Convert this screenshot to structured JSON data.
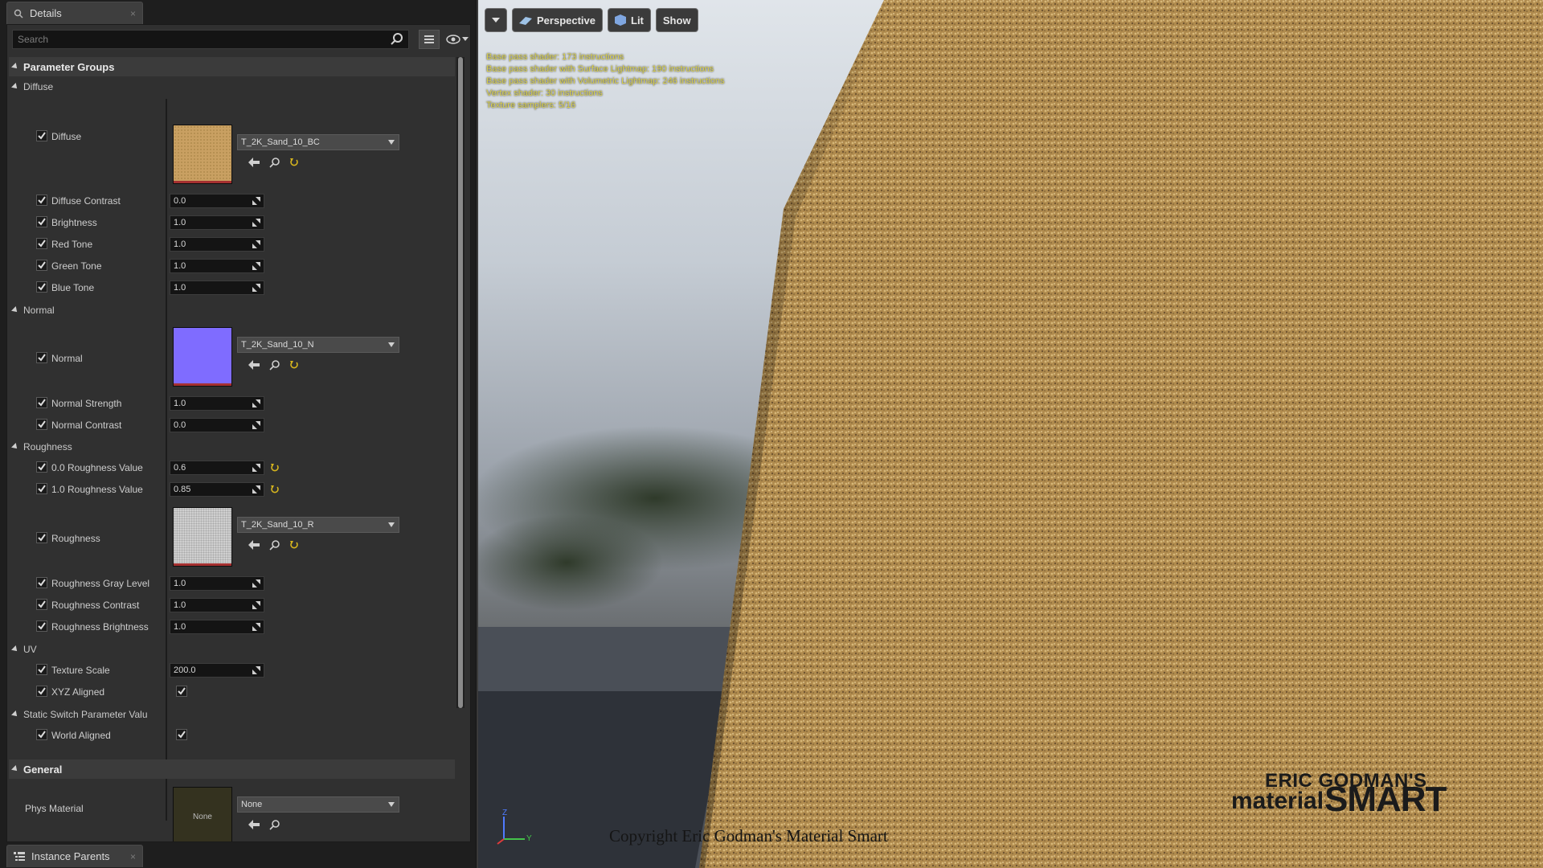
{
  "details_tab": {
    "title": "Details",
    "close": "×"
  },
  "search": {
    "placeholder": "Search"
  },
  "categories": {
    "parameter_groups": "Parameter Groups",
    "general": "General"
  },
  "groups": {
    "diffuse": "Diffuse",
    "normal": "Normal",
    "roughness": "Roughness",
    "uv": "UV",
    "static_switch": "Static Switch Parameter Valu"
  },
  "diffuse": {
    "texture_label": "Diffuse",
    "texture_name": "T_2K_Sand_10_BC",
    "params": [
      {
        "label": "Diffuse Contrast",
        "value": "0.0"
      },
      {
        "label": "Brightness",
        "value": "1.0"
      },
      {
        "label": "Red Tone",
        "value": "1.0"
      },
      {
        "label": "Green Tone",
        "value": "1.0"
      },
      {
        "label": "Blue Tone",
        "value": "1.0"
      }
    ]
  },
  "normal": {
    "texture_label": "Normal",
    "texture_name": "T_2K_Sand_10_N",
    "params": [
      {
        "label": "Normal Strength",
        "value": "1.0"
      },
      {
        "label": "Normal Contrast",
        "value": "0.0"
      }
    ]
  },
  "roughness": {
    "values": [
      {
        "label": "0.0 Roughness Value",
        "value": "0.6"
      },
      {
        "label": "1.0 Roughness Value",
        "value": "0.85"
      }
    ],
    "texture_label": "Roughness",
    "texture_name": "T_2K_Sand_10_R",
    "params": [
      {
        "label": "Roughness Gray Level",
        "value": "1.0"
      },
      {
        "label": "Roughness Contrast",
        "value": "1.0"
      },
      {
        "label": "Roughness Brightness",
        "value": "1.0"
      }
    ]
  },
  "uv": {
    "texture_scale_label": "Texture Scale",
    "texture_scale_value": "200.0",
    "xyz_aligned_label": "XYZ Aligned"
  },
  "static_switch": {
    "world_aligned_label": "World Aligned"
  },
  "general": {
    "phys_material_label": "Phys Material",
    "thumb_text": "None",
    "combo_value": "None"
  },
  "instance_parents_tab": {
    "title": "Instance Parents",
    "close": "×"
  },
  "viewport": {
    "perspective": "Perspective",
    "lit": "Lit",
    "show": "Show",
    "stats": [
      "Base pass shader: 173 instructions",
      "Base pass shader with Surface Lightmap: 190 instructions",
      "Base pass shader with Volumetric Lightmap: 246 instructions",
      "Vertex shader: 30 instructions",
      "Texture samplers: 5/16"
    ],
    "copyright": "Copyright Eric Godman's Material Smart",
    "logo_line1": "ERIC GODMAN'S",
    "logo_line2": "material",
    "logo_line3": "SMART",
    "gizmo_z": "Z",
    "gizmo_y": "Y"
  },
  "colors": {
    "panel_bg": "#303030",
    "diffuse_swatch": "#c9a062",
    "normal_swatch": "#7f6cff",
    "roughness_swatch": "#cfcfcf",
    "stats_text": "#dcd24a"
  }
}
